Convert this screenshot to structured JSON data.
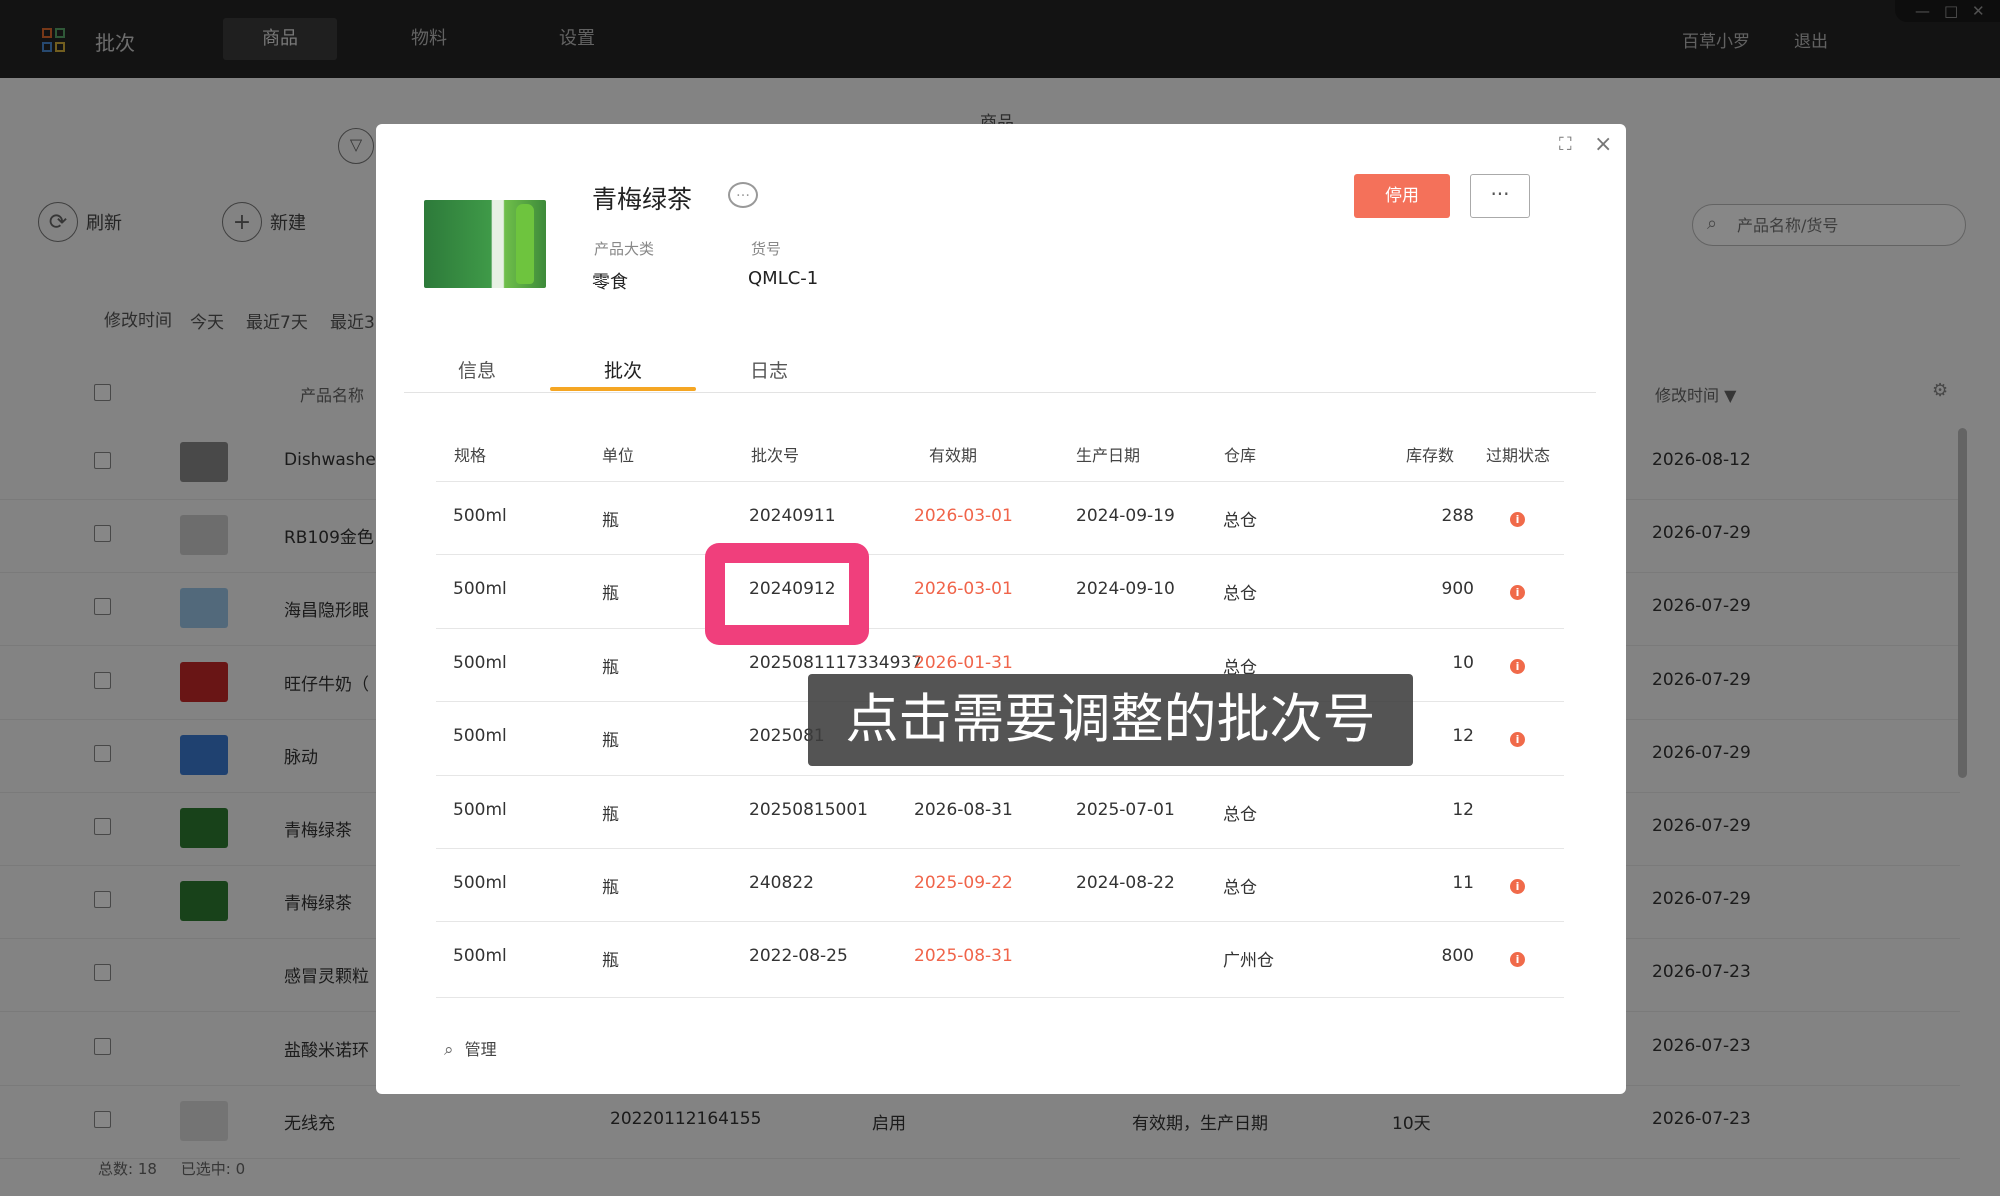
{
  "topbar": {
    "app_title": "批次",
    "nav": [
      "商品",
      "物料",
      "设置"
    ],
    "nav_active": 0,
    "user": "百草小罗",
    "logout": "退出",
    "window_controls": [
      "—",
      "□",
      "✕"
    ]
  },
  "page": {
    "heading": "商品",
    "toolbar": {
      "refresh": "刷新",
      "new": "新建"
    },
    "search_placeholder": "产品名称/货号",
    "filter_label": "修改时间",
    "filter_options": [
      "今天",
      "最近7天",
      "最近3"
    ],
    "columns": {
      "name": "产品名称",
      "modified": "修改时间 ▼"
    },
    "rows": [
      {
        "name": "Dishwashe",
        "date": "2026-08-12",
        "thumb": "#8a8a8a"
      },
      {
        "name": "RB109金色",
        "date": "2026-07-29",
        "thumb": "#cfcfcf"
      },
      {
        "name": "海昌隐形眼",
        "date": "2026-07-29",
        "thumb": "#9cc7e8"
      },
      {
        "name": "旺仔牛奶（",
        "date": "2026-07-29",
        "thumb": "#c62828"
      },
      {
        "name": "脉动",
        "date": "2026-07-29",
        "thumb": "#3b7bd4"
      },
      {
        "name": "青梅绿茶",
        "date": "2026-07-29",
        "thumb": "#2e7d32"
      },
      {
        "name": "青梅绿茶",
        "date": "2026-07-29",
        "thumb": "#2e7d32"
      },
      {
        "name": "感冒灵颗粒",
        "date": "2026-07-23",
        "thumb": ""
      },
      {
        "name": "盐酸米诺环",
        "date": "2026-07-23",
        "thumb": ""
      },
      {
        "name": "无线充",
        "date": "2026-07-23",
        "thumb": "#dcdcdc",
        "batch": "20220112164155",
        "status": "启用",
        "fields": "有效期，生产日期",
        "days": "10天"
      }
    ],
    "footer": {
      "total_label": "总数:",
      "total": "18",
      "selected_label": "已选中:",
      "selected": "0"
    }
  },
  "modal": {
    "product_name": "青梅绿茶",
    "category_label": "产品大类",
    "category": "零食",
    "sku_label": "货号",
    "sku": "QMLC-1",
    "disable_button": "停用",
    "more_button": "···",
    "tabs": [
      "信息",
      "批次",
      "日志"
    ],
    "active_tab": 1,
    "headers": [
      "规格",
      "单位",
      "批次号",
      "有效期",
      "生产日期",
      "仓库",
      "库存数",
      "过期状态"
    ],
    "rows": [
      {
        "spec": "500ml",
        "unit": "瓶",
        "batch": "20240911",
        "expiry": "2026-03-01",
        "expiry_red": true,
        "mfg": "2024-09-19",
        "warehouse": "总仓",
        "stock": "288",
        "expired": true
      },
      {
        "spec": "500ml",
        "unit": "瓶",
        "batch": "20240912",
        "expiry": "2026-03-01",
        "expiry_red": true,
        "mfg": "2024-09-10",
        "warehouse": "总仓",
        "stock": "900",
        "expired": true
      },
      {
        "spec": "500ml",
        "unit": "瓶",
        "batch": "2025081117334937",
        "expiry": "2026-01-31",
        "expiry_red": true,
        "mfg": "",
        "warehouse": "总仓",
        "stock": "10",
        "expired": true
      },
      {
        "spec": "500ml",
        "unit": "瓶",
        "batch": "2025081",
        "expiry": "",
        "expiry_red": true,
        "mfg": "",
        "warehouse": "",
        "stock": "12",
        "expired": true
      },
      {
        "spec": "500ml",
        "unit": "瓶",
        "batch": "20250815001",
        "expiry": "2026-08-31",
        "expiry_red": false,
        "mfg": "2025-07-01",
        "warehouse": "总仓",
        "stock": "12",
        "expired": false
      },
      {
        "spec": "500ml",
        "unit": "瓶",
        "batch": "240822",
        "expiry": "2025-09-22",
        "expiry_red": true,
        "mfg": "2024-08-22",
        "warehouse": "总仓",
        "stock": "11",
        "expired": true
      },
      {
        "spec": "500ml",
        "unit": "瓶",
        "batch": "2022-08-25",
        "expiry": "2025-08-31",
        "expiry_red": true,
        "mfg": "",
        "warehouse": "广州仓",
        "stock": "800",
        "expired": true
      }
    ],
    "expired_icon": "i",
    "manage_label": "管理"
  },
  "tutorial": {
    "caption": "点击需要调整的批次号",
    "highlight_color": "#f03f7c"
  },
  "colors": {
    "accent": "#f4715a",
    "tab_underline": "#f5a623",
    "expired_red": "#f0644a"
  }
}
